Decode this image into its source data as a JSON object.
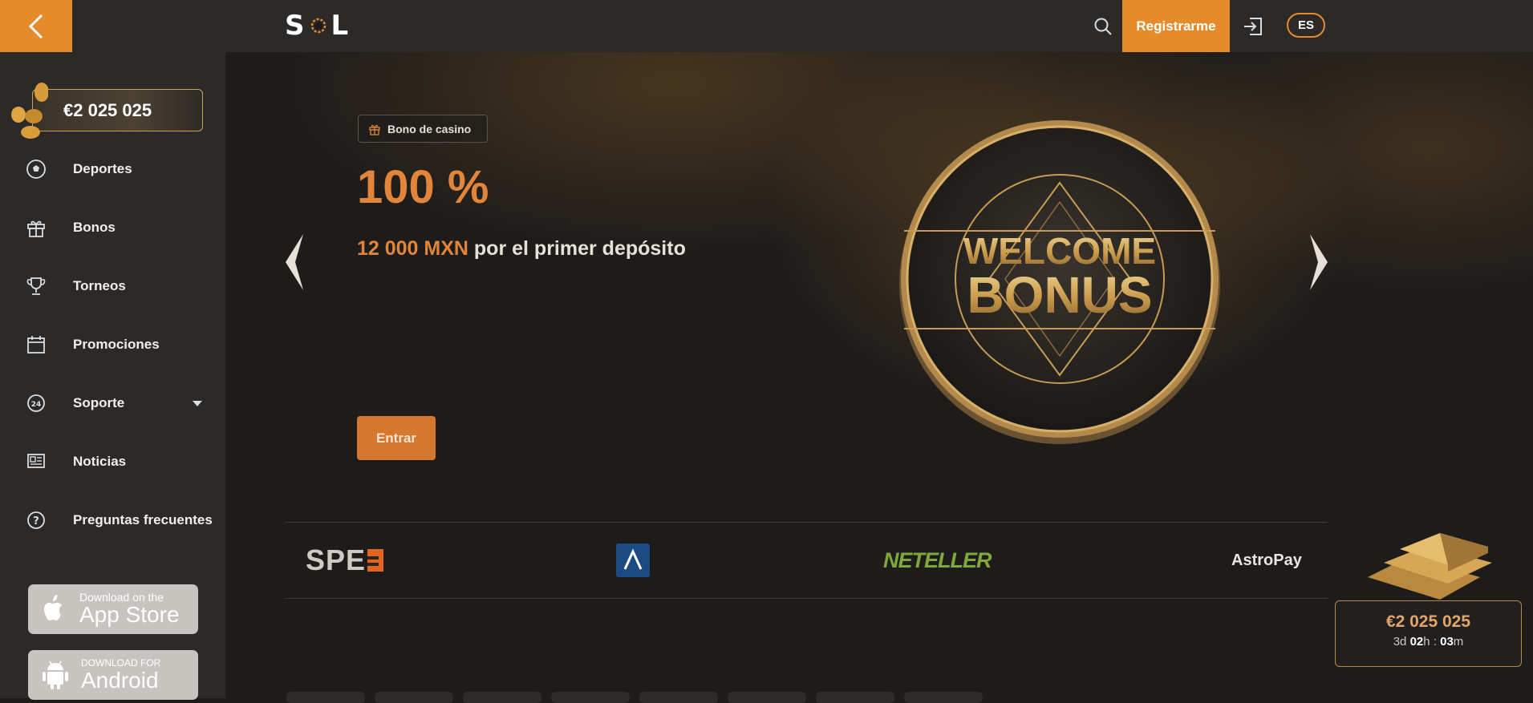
{
  "header": {
    "logo_text_left": "S",
    "logo_text_right": "L",
    "register_label": "Registrarme",
    "language": "ES",
    "accent_color": "#e58b2c"
  },
  "sidebar": {
    "jackpot": "€2 025 025",
    "items": [
      {
        "label": "Deportes",
        "icon": "soccer-ball-icon"
      },
      {
        "label": "Bonos",
        "icon": "gift-icon"
      },
      {
        "label": "Torneos",
        "icon": "trophy-icon"
      },
      {
        "label": "Promociones",
        "icon": "calendar-icon"
      },
      {
        "label": "Soporte",
        "icon": "support-24-icon"
      },
      {
        "label": "Noticias",
        "icon": "news-icon"
      },
      {
        "label": "Preguntas frecuentes",
        "icon": "question-icon"
      }
    ],
    "app_store": {
      "small": "Download on the",
      "big": "App Store"
    },
    "android": {
      "small": "DOWNLOAD FOR",
      "big": "Android"
    }
  },
  "hero": {
    "tag": "Bono de casino",
    "percent": "100 %",
    "amount": "12 000 MXN",
    "description": " por el primer depósito",
    "cta": "Entrar",
    "image_line1": "WELCOME",
    "image_line2": "BONUS"
  },
  "payments": [
    {
      "name": "SPEI",
      "display": "SPE"
    },
    {
      "name": "AstroPay Card",
      "display": ""
    },
    {
      "name": "NETELLER",
      "display": "NETELLER"
    },
    {
      "name": "AstroPay",
      "display": "AstroPay"
    }
  ],
  "jackpot_widget": {
    "amount": "€2 025 025",
    "days": "3",
    "hours": "02",
    "minutes": "03"
  }
}
